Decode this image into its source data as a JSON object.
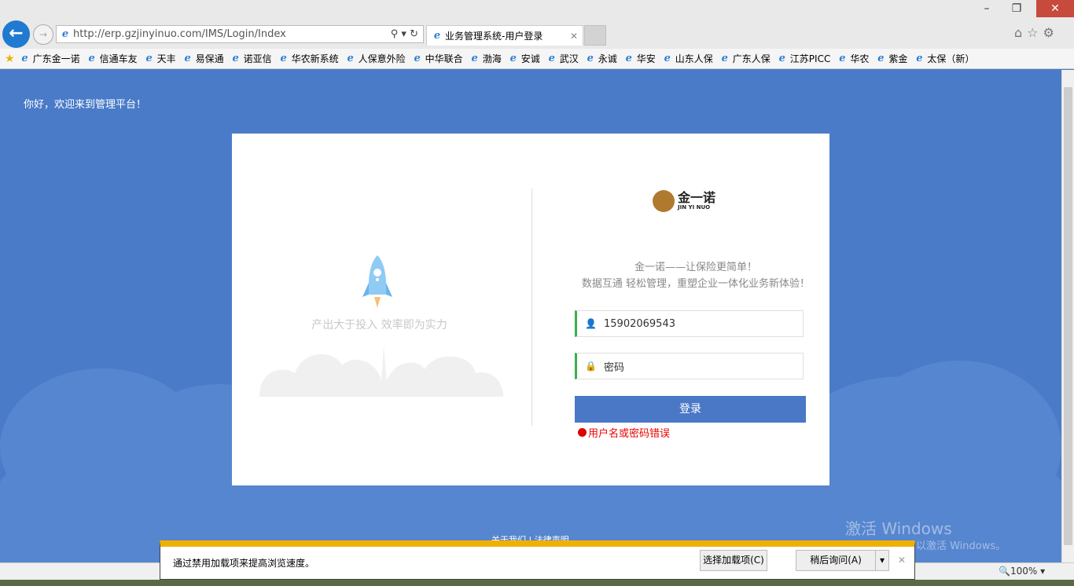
{
  "browser": {
    "url": "http://erp.gzjinyinuo.com/IMS/Login/Index",
    "tab_title": "业务管理系统-用户登录",
    "zoom": "100%"
  },
  "favorites": [
    "广东金一诺",
    "信通车友",
    "天丰",
    "易保通",
    "诺亚信",
    "华农新系统",
    "人保意外险",
    "中华联合",
    "渤海",
    "安诚",
    "武汉",
    "永诚",
    "华安",
    "山东人保",
    "广东人保",
    "江苏PICC",
    "华农",
    "紫金",
    "太保（新）"
  ],
  "page": {
    "welcome": "你好，欢迎来到管理平台！",
    "slogan": "产出大于投入  效率即为实力",
    "logo_cn": "金一诺",
    "logo_en": "JIN YI NUO",
    "tagline1": "金一诺——让保险更简单！",
    "tagline2": "数据互通 轻松管理，重塑企业一体化业务新体验！",
    "username": "15902069543",
    "password_placeholder": "密码",
    "login_label": "登录",
    "error": "用户名或密码错误",
    "footer": "关于我们 | 法律声明"
  },
  "notification": {
    "message": "通过禁用加载项来提高浏览速度。",
    "choose": "选择加载项(C)",
    "later": "稍后询问(A)"
  },
  "watermark": {
    "line1": "激活 Windows",
    "line2": "转到\"电脑设置\"以激活 Windows。"
  },
  "colors": {
    "page_bg": "#4a7bc8",
    "button": "#4a78c7",
    "error": "#e00000",
    "accent_green": "#3cb04a"
  }
}
